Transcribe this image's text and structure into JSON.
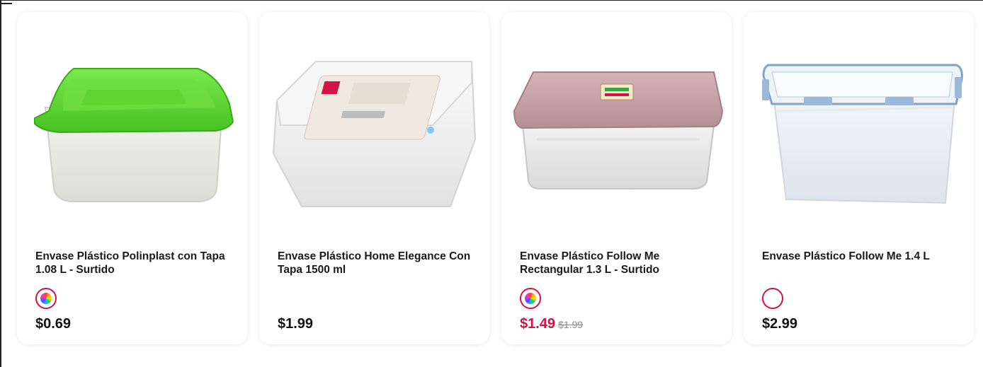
{
  "products": [
    {
      "title": "Envase Plástico Polinplast con Tapa 1.08 L - Surtido",
      "price": "$0.69",
      "swatch": "multicolor"
    },
    {
      "title": "Envase Plástico Home Elegance Con Tapa 1500 ml",
      "price": "$1.99",
      "swatch": null
    },
    {
      "title": "Envase Plástico Follow Me Rectangular 1.3 L - Surtido",
      "price": "$1.49",
      "old_price": "$1.99",
      "swatch": "multicolor"
    },
    {
      "title": "Envase Plástico Follow Me 1.4 L",
      "price": "$2.99",
      "swatch": "white"
    }
  ],
  "colors": {
    "accent": "#d31245",
    "lid_green": "#5fd93a",
    "lid_pink": "#c9a4aa",
    "lid_blue": "#6e95c8"
  },
  "icons": {
    "swatch_multicolor": "color-wheel-icon",
    "swatch_white": "empty-circle-icon"
  }
}
